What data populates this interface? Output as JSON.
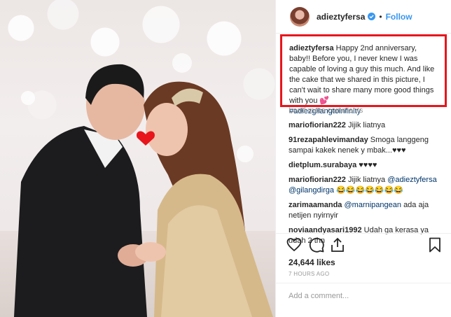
{
  "post": {
    "username": "adieztyfersa",
    "follow_label": "Follow",
    "separator": "•"
  },
  "caption": {
    "username": "adieztyfersa",
    "text": "Happy 2nd anniversary, baby!! Before you, I never knew I was capable of loving a guy this much. And like the cake that we shared in this picture, I can't wait to share many more good things with you 💕",
    "hashtag": "#adiezgilangtoinfinity"
  },
  "load_more_label": "Load more comments",
  "comments": [
    {
      "user": "mariofiorian222",
      "text": "Jijik liatnya"
    },
    {
      "user": "91rezapahlevimanday",
      "text": "Smoga langgeng sampai kakek nenek y mbak...♥♥♥"
    },
    {
      "user": "dietplum.surabaya",
      "text": "♥♥♥♥"
    },
    {
      "user": "mariofiorian222",
      "text": "Jijik liatnya",
      "mentions": "@adieztyfersa @gilangdirga",
      "trail": "😂😂😂😂😂😂😂"
    },
    {
      "user": "zarimaamanda",
      "mention": "@marnipangean",
      "text": "ada aja netijen nyirnyir"
    },
    {
      "user": "noviaandyasari1992",
      "text": "Udah ga kerasa ya udah 2 thn"
    }
  ],
  "actions": {
    "like_icon": "heart-icon",
    "comment_icon": "comment-icon",
    "share_icon": "share-icon",
    "save_icon": "bookmark-icon"
  },
  "likes": "24,644 likes",
  "timestamp": "7 HOURS AGO",
  "add_comment_placeholder": "Add a comment...",
  "colors": {
    "highlight_border": "#e8151c",
    "link_blue": "#3897f0",
    "hashtag_blue": "#003569"
  }
}
